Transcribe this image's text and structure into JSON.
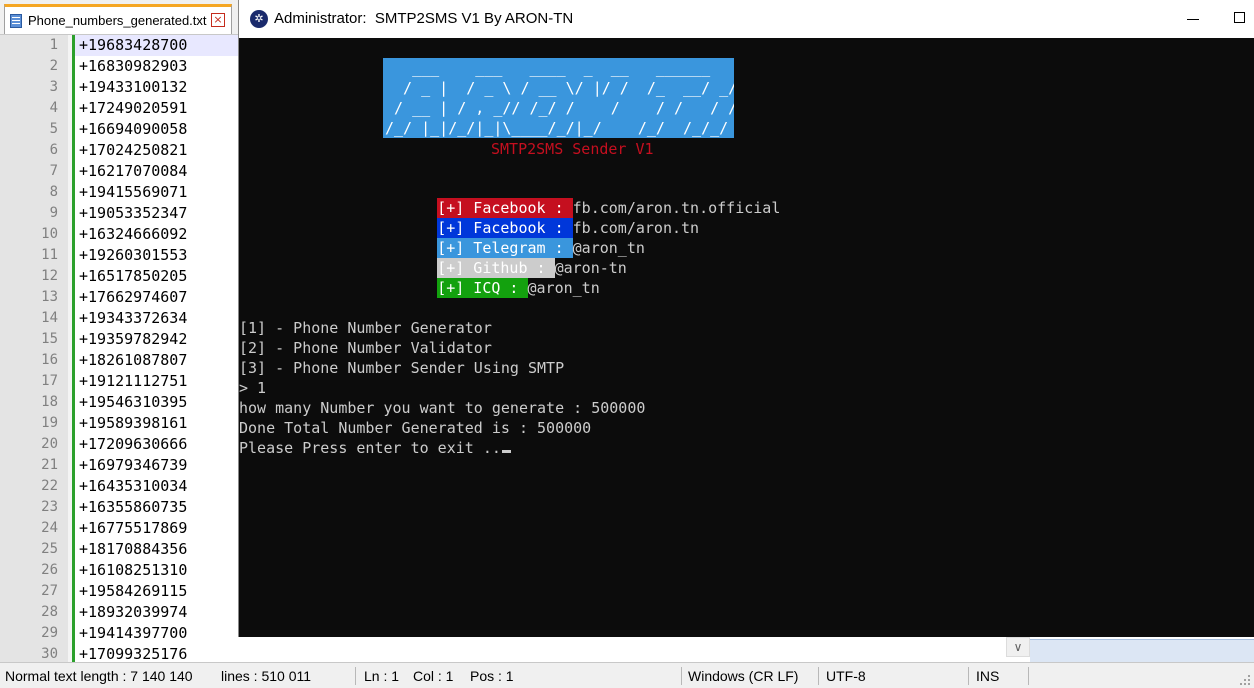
{
  "notepad": {
    "tab_label": "Phone_numbers_generated.txt",
    "tab_close": "×",
    "lines": [
      {
        "n": "1",
        "text": "+19683428700"
      },
      {
        "n": "2",
        "text": "+16830982903"
      },
      {
        "n": "3",
        "text": "+19433100132"
      },
      {
        "n": "4",
        "text": "+17249020591"
      },
      {
        "n": "5",
        "text": "+16694090058"
      },
      {
        "n": "6",
        "text": "+17024250821"
      },
      {
        "n": "7",
        "text": "+16217070084"
      },
      {
        "n": "8",
        "text": "+19415569071"
      },
      {
        "n": "9",
        "text": "+19053352347"
      },
      {
        "n": "10",
        "text": "+16324666092"
      },
      {
        "n": "11",
        "text": "+19260301553"
      },
      {
        "n": "12",
        "text": "+16517850205"
      },
      {
        "n": "13",
        "text": "+17662974607"
      },
      {
        "n": "14",
        "text": "+19343372634"
      },
      {
        "n": "15",
        "text": "+19359782942"
      },
      {
        "n": "16",
        "text": "+18261087807"
      },
      {
        "n": "17",
        "text": "+19121112751"
      },
      {
        "n": "18",
        "text": "+19546310395"
      },
      {
        "n": "19",
        "text": "+19589398161"
      },
      {
        "n": "20",
        "text": "+17209630666"
      },
      {
        "n": "21",
        "text": "+16979346739"
      },
      {
        "n": "22",
        "text": "+16435310034"
      },
      {
        "n": "23",
        "text": "+16355860735"
      },
      {
        "n": "24",
        "text": "+16775517869"
      },
      {
        "n": "25",
        "text": "+18170884356"
      },
      {
        "n": "26",
        "text": "+16108251310"
      },
      {
        "n": "27",
        "text": "+19584269115"
      },
      {
        "n": "28",
        "text": "+18932039974"
      },
      {
        "n": "29",
        "text": "+19414397700"
      },
      {
        "n": "30",
        "text": "+17099325176"
      }
    ],
    "scroll_arrow": "∨",
    "status": {
      "length": "Normal text length : 7 140 140",
      "lines": "lines : 510 011",
      "ln": "Ln : 1",
      "col": "Col : 1",
      "pos": "Pos : 1",
      "eol": "Windows (CR LF)",
      "encoding": "UTF-8",
      "mode": "INS"
    }
  },
  "console": {
    "title": "Administrator:  SMTP2SMS V1 By ARON-TN",
    "icon_glyph": "✲",
    "banner_lines": [
      "   ___    ___   ____  _  __   ______   __",
      "  / _ |  / _ \\ / __ \\/ |/ /  /_  __/ _/ /",
      " / __ | / , _// /_/ /    /    / /   / /",
      "/_/ |_|/_/|_|\\____/_/|_/    /_/  /_/_/"
    ],
    "subtitle": "SMTP2SMS Sender V1",
    "links": [
      {
        "tag": "[+] Facebook : ",
        "value": "fb.com/aron.tn.official",
        "bg": "#c50f1f"
      },
      {
        "tag": "[+] Facebook : ",
        "value": "fb.com/aron.tn",
        "bg": "#0037da"
      },
      {
        "tag": "[+] Telegram : ",
        "value": "@aron_tn",
        "bg": "#3a96dd"
      },
      {
        "tag": "[+] Github : ",
        "value": "@aron-tn",
        "bg": "#cccccc"
      },
      {
        "tag": "[+] ICQ : ",
        "value": "@aron_tn",
        "bg": "#13a10e"
      }
    ],
    "menu": [
      "[1] - Phone Number Generator",
      "[2] - Phone Number Validator",
      "[3] - Phone Number Sender Using SMTP"
    ],
    "prompt": "> 1",
    "question": "how many Number you want to generate : 500000",
    "result": "Done Total Number Generated is : 500000",
    "exit_msg": "Please Press enter to exit .."
  }
}
